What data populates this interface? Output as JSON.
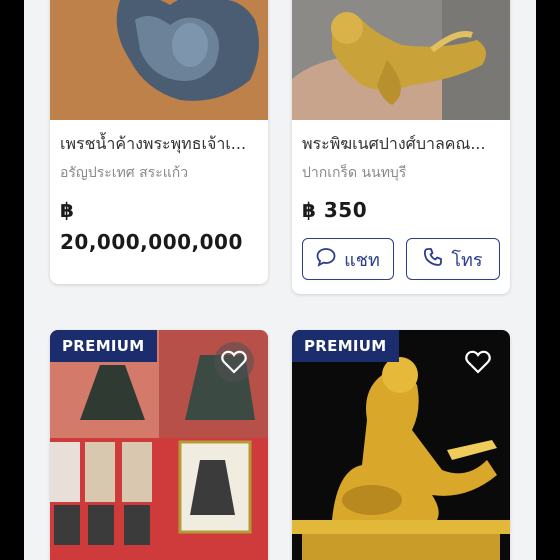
{
  "listings": [
    {
      "title": "เพรชน้ำค้างพระพุทธเจ้าเ...",
      "location": "อรัญประเทศ สระแก้ว",
      "currency": "฿",
      "price": "20,000,000,000"
    },
    {
      "title": "พระพิฆเนศปางศ์บาลคณ...",
      "location": "ปากเกร็ด นนทบุรี",
      "price": "฿ 350",
      "chat_label": "แชท",
      "call_label": "โทร"
    },
    {
      "badge": "PREMIUM"
    },
    {
      "badge": "PREMIUM"
    }
  ],
  "icons": [
    "chat-bubble-icon",
    "phone-icon",
    "heart-icon"
  ],
  "colors": {
    "brand": "#1c2d6e",
    "button_outline": "#2c3e8c",
    "background": "#f2f3f5"
  }
}
